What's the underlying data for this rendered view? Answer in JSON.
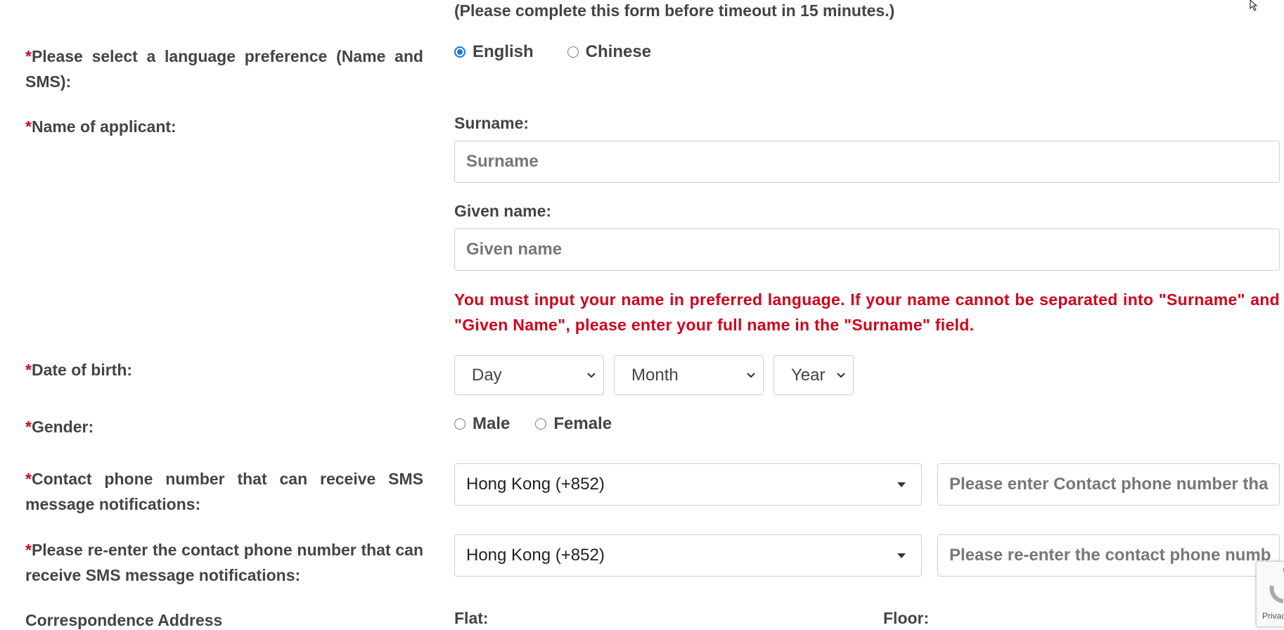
{
  "form": {
    "timeout_notice": "(Please complete this form before timeout in 15 minutes.)",
    "required_mark": "*",
    "language": {
      "label": "Please select a language preference (Name and SMS):",
      "options": [
        "English",
        "Chinese"
      ],
      "selected": "English"
    },
    "name": {
      "label": "Name of applicant:",
      "surname_label": "Surname:",
      "surname_placeholder": "Surname",
      "given_label": "Given name:",
      "given_placeholder": "Given name",
      "warning": "You must input your name in preferred language. If your name cannot be separated into \"Surname\" and \"Given Name\", please enter your full name in the \"Surname\" field."
    },
    "dob": {
      "label": "Date of birth:",
      "day": "Day",
      "month": "Month",
      "year": "Year"
    },
    "gender": {
      "label": "Gender:",
      "options": [
        "Male",
        "Female"
      ]
    },
    "phone": {
      "label": "Contact phone number that can receive SMS message notifications:",
      "country": "Hong Kong (+852)",
      "placeholder": "Please enter Contact phone number tha"
    },
    "phone_confirm": {
      "label": "Please re-enter the contact phone number that can receive SMS message notifications:",
      "country": "Hong Kong (+852)",
      "placeholder": "Please re-enter the contact phone numb"
    },
    "address": {
      "label": "Correspondence Address",
      "flat_label": "Flat:",
      "floor_label": "Floor:"
    }
  },
  "recaptcha": {
    "privacy_text": "Privac"
  },
  "colors": {
    "required": "#d0021b",
    "radio_checked": "#1a73e8"
  }
}
